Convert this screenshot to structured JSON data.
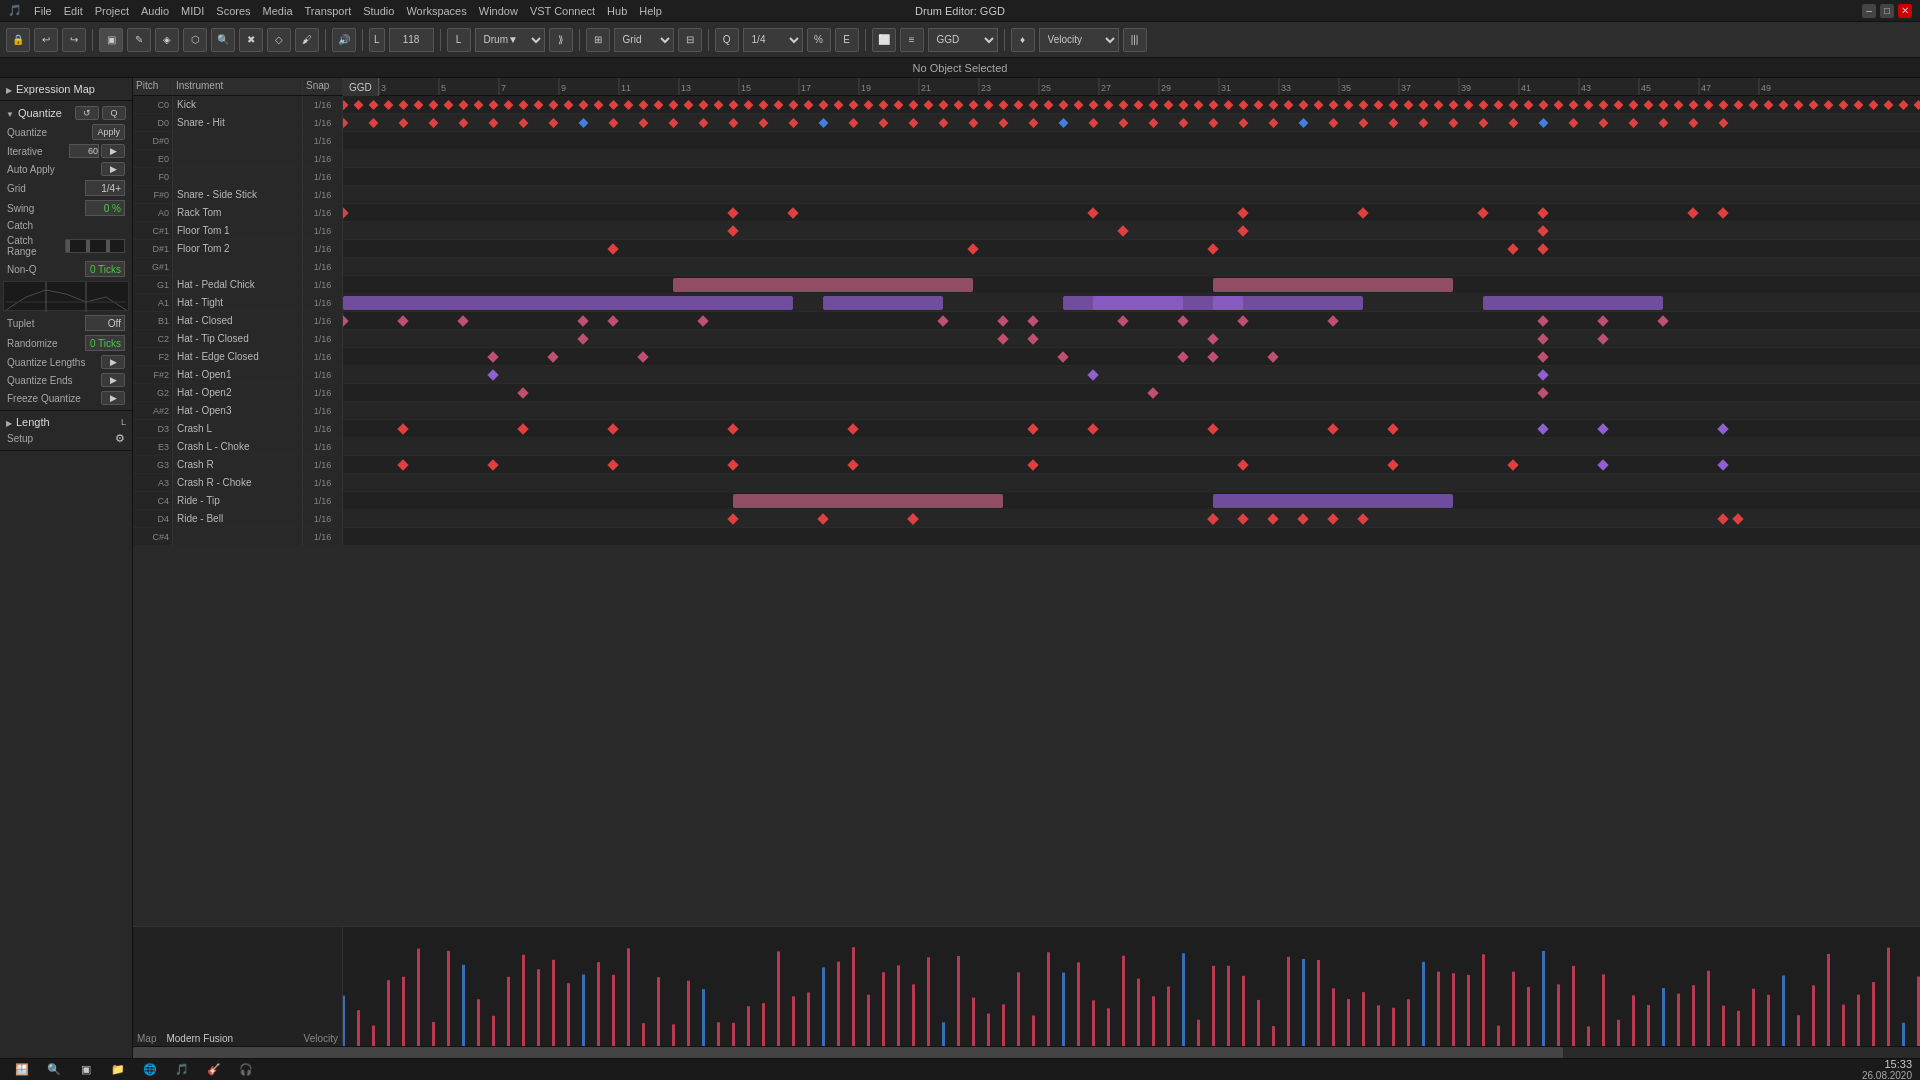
{
  "titlebar": {
    "app_icon": "cubase-icon",
    "menus": [
      "File",
      "Edit",
      "Project",
      "Audio",
      "MIDI",
      "Scores",
      "Media",
      "Transport",
      "Studio",
      "Workspaces",
      "Window",
      "VST Connect",
      "Hub",
      "Help"
    ],
    "title": "Drum Editor: GGD",
    "win_min": "–",
    "win_max": "□",
    "win_close": "✕"
  },
  "toolbar": {
    "tempo": "118",
    "tempo_label": "L",
    "drum_label": "Drum▼",
    "grid_label": "Grid",
    "grid_value": "Grid",
    "quantize_label": "Q",
    "quantize_value": "1/4",
    "ggd_label": "GGD",
    "velocity_label": "Velocity",
    "bars_icon": "|||"
  },
  "status": {
    "text": "No Object Selected"
  },
  "left_panel": {
    "expression_map": {
      "label": "Expression Map",
      "expanded": true
    },
    "quantize": {
      "label": "Quantize",
      "quantize_value": "Quantize",
      "iterative": "60",
      "iterative_label": "Iterative",
      "auto_apply_label": "Auto Apply",
      "grid_label": "Grid",
      "grid_value": "1/4+",
      "swing_label": "Swing",
      "swing_value": "0 %",
      "catch_label": "Catch",
      "catch_range_label": "Catch Range",
      "non_q_label": "Non-Q",
      "non_q_value": "0 Ticks",
      "tuplet_label": "Tuplet",
      "tuplet_value": "Off",
      "randomize_label": "Randomize",
      "randomize_value": "0 Ticks",
      "quantize_lengths_label": "Quantize Lengths",
      "quantize_ends_label": "Quantize Ends",
      "freeze_quantize_label": "Freeze Quantize"
    },
    "length": {
      "label": "Length",
      "setup_label": "Setup",
      "setup_icon": "gear"
    }
  },
  "grid": {
    "ggd_label": "GGD",
    "ruler_marks": [
      "3",
      "5",
      "7",
      "9",
      "11",
      "13",
      "15",
      "17",
      "19",
      "21",
      "23",
      "25",
      "27",
      "29",
      "31",
      "33",
      "35",
      "37",
      "39",
      "41",
      "43",
      "45",
      "47",
      "49"
    ],
    "rows": [
      {
        "pitch": "C0",
        "instrument": "Kick",
        "snap": "1/16",
        "alt": false
      },
      {
        "pitch": "D0",
        "instrument": "Snare - Hit",
        "snap": "1/16",
        "alt": true
      },
      {
        "pitch": "D#0",
        "instrument": "",
        "snap": "1/16",
        "alt": false
      },
      {
        "pitch": "E0",
        "instrument": "",
        "snap": "1/16",
        "alt": true
      },
      {
        "pitch": "F0",
        "instrument": "",
        "snap": "1/16",
        "alt": false
      },
      {
        "pitch": "F#0",
        "instrument": "Snare - Side Stick",
        "snap": "1/16",
        "alt": true
      },
      {
        "pitch": "A0",
        "instrument": "Rack Tom",
        "snap": "1/16",
        "alt": false
      },
      {
        "pitch": "C#1",
        "instrument": "Floor Tom 1",
        "snap": "1/16",
        "alt": true
      },
      {
        "pitch": "D#1",
        "instrument": "Floor Tom 2",
        "snap": "1/16",
        "alt": false
      },
      {
        "pitch": "G#1",
        "instrument": "",
        "snap": "1/16",
        "alt": true
      },
      {
        "pitch": "G1",
        "instrument": "Hat - Pedal Chick",
        "snap": "1/16",
        "alt": false
      },
      {
        "pitch": "A1",
        "instrument": "Hat - Tight",
        "snap": "1/16",
        "alt": true
      },
      {
        "pitch": "B1",
        "instrument": "Hat - Closed",
        "snap": "1/16",
        "alt": false
      },
      {
        "pitch": "C2",
        "instrument": "Hat - Tip Closed",
        "snap": "1/16",
        "alt": true
      },
      {
        "pitch": "F2",
        "instrument": "Hat - Edge Closed",
        "snap": "1/16",
        "alt": false
      },
      {
        "pitch": "F#2",
        "instrument": "Hat - Open1",
        "snap": "1/16",
        "alt": true
      },
      {
        "pitch": "G2",
        "instrument": "Hat - Open2",
        "snap": "1/16",
        "alt": false
      },
      {
        "pitch": "A#2",
        "instrument": "Hat - Open3",
        "snap": "1/16",
        "alt": true
      },
      {
        "pitch": "D3",
        "instrument": "Crash L",
        "snap": "1/16",
        "alt": false
      },
      {
        "pitch": "E3",
        "instrument": "Crash L - Choke",
        "snap": "1/16",
        "alt": true
      },
      {
        "pitch": "G3",
        "instrument": "Crash R",
        "snap": "1/16",
        "alt": false
      },
      {
        "pitch": "A3",
        "instrument": "Crash R - Choke",
        "snap": "1/16",
        "alt": true
      },
      {
        "pitch": "C4",
        "instrument": "Ride - Tip",
        "snap": "1/16",
        "alt": false
      },
      {
        "pitch": "D4",
        "instrument": "Ride - Bell",
        "snap": "1/16",
        "alt": true
      },
      {
        "pitch": "C#4",
        "instrument": "",
        "snap": "1/16",
        "alt": false
      }
    ]
  },
  "velocity_section": {
    "map_label": "Map",
    "modern_fusion_label": "Modern Fusion",
    "velocity_label": "Velocity"
  },
  "taskbar": {
    "time": "15:33",
    "date": "26.08.2020"
  }
}
